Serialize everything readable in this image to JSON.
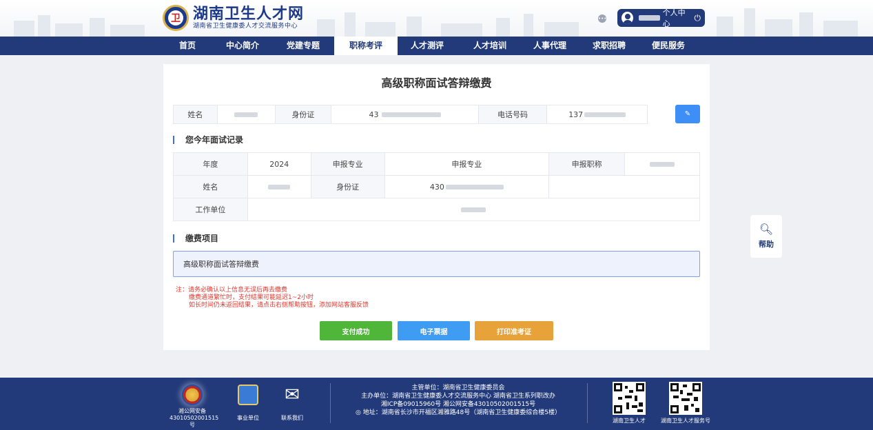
{
  "header": {
    "site_title": "湖南卫生人才网",
    "site_subtitle": "湖南省卫生健康委人才交流服务中心",
    "user_center": "个人中心"
  },
  "nav": {
    "items": [
      "首页",
      "中心简介",
      "党建专题",
      "职称考评",
      "人才测评",
      "人才培训",
      "人事代理",
      "求职招聘",
      "便民服务"
    ],
    "active": "职称考评"
  },
  "page": {
    "title": "高级职称面试答辩缴费"
  },
  "info": {
    "name_label": "姓名",
    "id_label": "身份证",
    "id_value_prefix": "43",
    "phone_label": "电话号码",
    "phone_value_prefix": "137"
  },
  "record": {
    "section_title": "您今年面试记录",
    "year_label": "年度",
    "year_value": "2024",
    "major_label": "申报专业",
    "major_value": "申报专业",
    "title_label": "申报职称",
    "name_label": "姓名",
    "id_label": "身份证",
    "id_value_prefix": "430",
    "work_label": "工作单位"
  },
  "fee": {
    "section_title": "缴费项目",
    "item": "高级职称面试答辩缴费"
  },
  "notes": {
    "line1": "注：请务必确认以上信息无误后再去缴费",
    "line2": "缴费通道繁忙时，支付结果可能延迟1~2小时",
    "line3": "如长时间仍未返回结果，请点击右侧帮助按钮，添加网站客服反馈"
  },
  "buttons": {
    "paid": "支付成功",
    "invoice": "电子票据",
    "print": "打印准考证"
  },
  "help": {
    "label": "帮助"
  },
  "footer": {
    "police_line1": "湘公网安备",
    "police_line2": "43010502001515号",
    "public_unit": "事业单位",
    "contact": "联系我们",
    "line1": "主管单位：湖南省卫生健康委员会",
    "line2": "主办单位：湖南省卫生健康委人才交流服务中心 湖南省卫生系列职改办",
    "line3": "湘ICP备09015960号 湘公网安备43010502001515号",
    "line4": "地址：湖南省长沙市开福区湘雅路48号（湖南省卫生健康委综合楼5楼）",
    "qr1_label": "湖南卫生人才",
    "qr2_label": "湖南卫生人才服务号"
  },
  "colors": {
    "primary": "#223a7a",
    "accent_blue": "#3e8ef7",
    "success": "#4fb63a",
    "warning": "#e8a23a",
    "note_red": "#e0352b"
  }
}
